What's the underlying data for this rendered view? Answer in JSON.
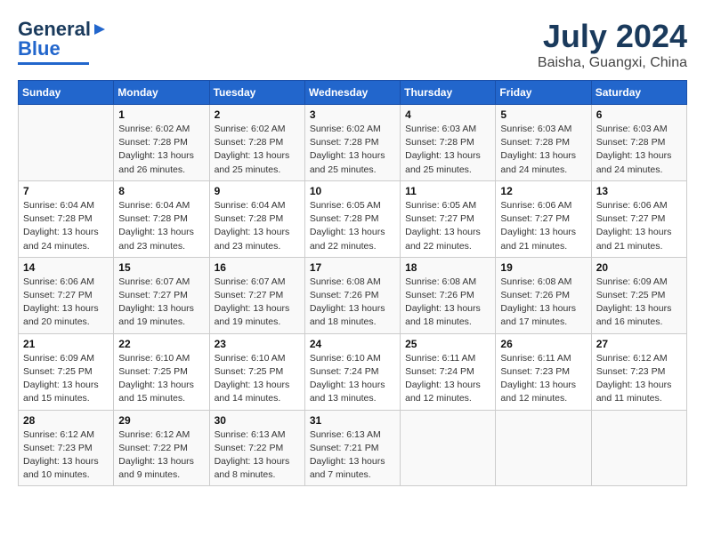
{
  "header": {
    "logo_line1": "General",
    "logo_line2": "Blue",
    "month_year": "July 2024",
    "location": "Baisha, Guangxi, China"
  },
  "days_of_week": [
    "Sunday",
    "Monday",
    "Tuesday",
    "Wednesday",
    "Thursday",
    "Friday",
    "Saturday"
  ],
  "weeks": [
    [
      {
        "day": "",
        "info": ""
      },
      {
        "day": "1",
        "info": "Sunrise: 6:02 AM\nSunset: 7:28 PM\nDaylight: 13 hours\nand 26 minutes."
      },
      {
        "day": "2",
        "info": "Sunrise: 6:02 AM\nSunset: 7:28 PM\nDaylight: 13 hours\nand 25 minutes."
      },
      {
        "day": "3",
        "info": "Sunrise: 6:02 AM\nSunset: 7:28 PM\nDaylight: 13 hours\nand 25 minutes."
      },
      {
        "day": "4",
        "info": "Sunrise: 6:03 AM\nSunset: 7:28 PM\nDaylight: 13 hours\nand 25 minutes."
      },
      {
        "day": "5",
        "info": "Sunrise: 6:03 AM\nSunset: 7:28 PM\nDaylight: 13 hours\nand 24 minutes."
      },
      {
        "day": "6",
        "info": "Sunrise: 6:03 AM\nSunset: 7:28 PM\nDaylight: 13 hours\nand 24 minutes."
      }
    ],
    [
      {
        "day": "7",
        "info": "Sunrise: 6:04 AM\nSunset: 7:28 PM\nDaylight: 13 hours\nand 24 minutes."
      },
      {
        "day": "8",
        "info": "Sunrise: 6:04 AM\nSunset: 7:28 PM\nDaylight: 13 hours\nand 23 minutes."
      },
      {
        "day": "9",
        "info": "Sunrise: 6:04 AM\nSunset: 7:28 PM\nDaylight: 13 hours\nand 23 minutes."
      },
      {
        "day": "10",
        "info": "Sunrise: 6:05 AM\nSunset: 7:28 PM\nDaylight: 13 hours\nand 22 minutes."
      },
      {
        "day": "11",
        "info": "Sunrise: 6:05 AM\nSunset: 7:27 PM\nDaylight: 13 hours\nand 22 minutes."
      },
      {
        "day": "12",
        "info": "Sunrise: 6:06 AM\nSunset: 7:27 PM\nDaylight: 13 hours\nand 21 minutes."
      },
      {
        "day": "13",
        "info": "Sunrise: 6:06 AM\nSunset: 7:27 PM\nDaylight: 13 hours\nand 21 minutes."
      }
    ],
    [
      {
        "day": "14",
        "info": "Sunrise: 6:06 AM\nSunset: 7:27 PM\nDaylight: 13 hours\nand 20 minutes."
      },
      {
        "day": "15",
        "info": "Sunrise: 6:07 AM\nSunset: 7:27 PM\nDaylight: 13 hours\nand 19 minutes."
      },
      {
        "day": "16",
        "info": "Sunrise: 6:07 AM\nSunset: 7:27 PM\nDaylight: 13 hours\nand 19 minutes."
      },
      {
        "day": "17",
        "info": "Sunrise: 6:08 AM\nSunset: 7:26 PM\nDaylight: 13 hours\nand 18 minutes."
      },
      {
        "day": "18",
        "info": "Sunrise: 6:08 AM\nSunset: 7:26 PM\nDaylight: 13 hours\nand 18 minutes."
      },
      {
        "day": "19",
        "info": "Sunrise: 6:08 AM\nSunset: 7:26 PM\nDaylight: 13 hours\nand 17 minutes."
      },
      {
        "day": "20",
        "info": "Sunrise: 6:09 AM\nSunset: 7:25 PM\nDaylight: 13 hours\nand 16 minutes."
      }
    ],
    [
      {
        "day": "21",
        "info": "Sunrise: 6:09 AM\nSunset: 7:25 PM\nDaylight: 13 hours\nand 15 minutes."
      },
      {
        "day": "22",
        "info": "Sunrise: 6:10 AM\nSunset: 7:25 PM\nDaylight: 13 hours\nand 15 minutes."
      },
      {
        "day": "23",
        "info": "Sunrise: 6:10 AM\nSunset: 7:25 PM\nDaylight: 13 hours\nand 14 minutes."
      },
      {
        "day": "24",
        "info": "Sunrise: 6:10 AM\nSunset: 7:24 PM\nDaylight: 13 hours\nand 13 minutes."
      },
      {
        "day": "25",
        "info": "Sunrise: 6:11 AM\nSunset: 7:24 PM\nDaylight: 13 hours\nand 12 minutes."
      },
      {
        "day": "26",
        "info": "Sunrise: 6:11 AM\nSunset: 7:23 PM\nDaylight: 13 hours\nand 12 minutes."
      },
      {
        "day": "27",
        "info": "Sunrise: 6:12 AM\nSunset: 7:23 PM\nDaylight: 13 hours\nand 11 minutes."
      }
    ],
    [
      {
        "day": "28",
        "info": "Sunrise: 6:12 AM\nSunset: 7:23 PM\nDaylight: 13 hours\nand 10 minutes."
      },
      {
        "day": "29",
        "info": "Sunrise: 6:12 AM\nSunset: 7:22 PM\nDaylight: 13 hours\nand 9 minutes."
      },
      {
        "day": "30",
        "info": "Sunrise: 6:13 AM\nSunset: 7:22 PM\nDaylight: 13 hours\nand 8 minutes."
      },
      {
        "day": "31",
        "info": "Sunrise: 6:13 AM\nSunset: 7:21 PM\nDaylight: 13 hours\nand 7 minutes."
      },
      {
        "day": "",
        "info": ""
      },
      {
        "day": "",
        "info": ""
      },
      {
        "day": "",
        "info": ""
      }
    ]
  ]
}
